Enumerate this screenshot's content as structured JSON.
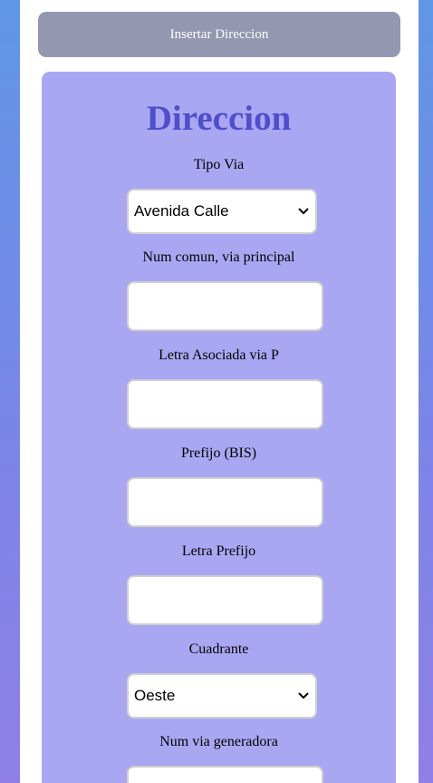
{
  "insert_button": {
    "label": "Insertar Direccion"
  },
  "form": {
    "title": "Direccion",
    "tipo_via": {
      "label": "Tipo Via",
      "selected": "Avenida Calle"
    },
    "num_comun": {
      "label": "Num comun, via principal",
      "value": ""
    },
    "letra_asociada": {
      "label": "Letra Asociada via P",
      "value": ""
    },
    "prefijo": {
      "label": "Prefijo (BIS)",
      "value": ""
    },
    "letra_prefijo": {
      "label": "Letra Prefijo",
      "value": ""
    },
    "cuadrante": {
      "label": "Cuadrante",
      "selected": "Oeste"
    },
    "num_via_generadora": {
      "label": "Num via generadora",
      "value": ""
    }
  },
  "colors": {
    "background_top": "#6096e6",
    "background_bottom": "#8f7fe6",
    "button": "#9497b0",
    "card": "#a9a7f2",
    "title": "#4f4fcb"
  },
  "icons": {
    "select_arrow": "chevron-down-icon"
  }
}
